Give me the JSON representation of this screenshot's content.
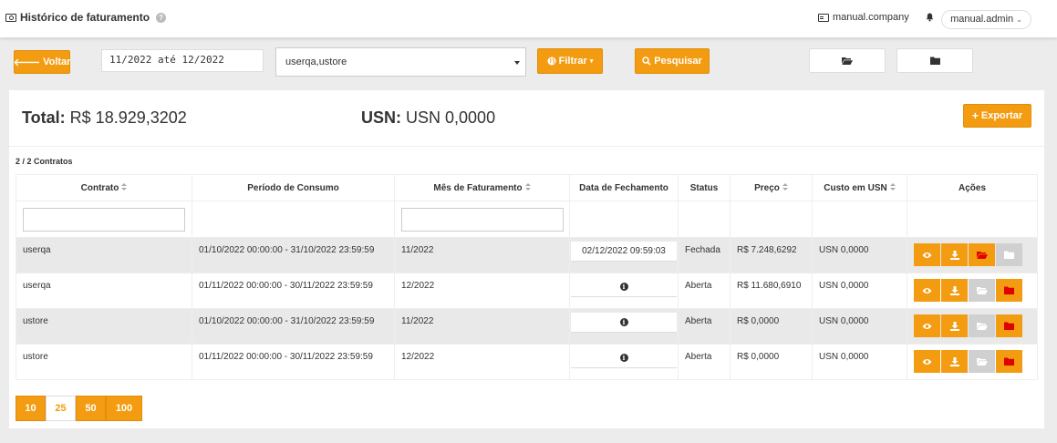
{
  "header": {
    "title": "Histórico de faturamento",
    "company": "manual.company",
    "user": "manual.admin"
  },
  "toolbar": {
    "back_label": "Voltar",
    "date_range": "11/2022 até 12/2022",
    "select_value": "userqa,ustore",
    "filter_label": "Filtrar",
    "search_label": "Pesquisar"
  },
  "summary": {
    "total_label": "Total:",
    "total_value": "R$ 18.929,3202",
    "usn_label": "USN:",
    "usn_value": "USN 0,0000",
    "export_label": "Exportar"
  },
  "table": {
    "count": "2 / 2 Contratos",
    "headers": [
      "Contrato",
      "Período de Consumo",
      "Mês de Faturamento",
      "Data de Fechamento",
      "Status",
      "Preço",
      "Custo em USN",
      "Ações"
    ],
    "rows": [
      {
        "contrato": "userqa",
        "periodo": "01/10/2022 00:00:00 - 31/10/2022 23:59:59",
        "mes": "11/2022",
        "fechamento": "02/12/2022 09:59:03",
        "status": "Fechada",
        "preco": "R$ 7.248,6292",
        "custo": "USN 0,0000"
      },
      {
        "contrato": "userqa",
        "periodo": "01/11/2022 00:00:00 - 30/11/2022 23:59:59",
        "mes": "12/2022",
        "fechamento": "",
        "status": "Aberta",
        "preco": "R$ 11.680,6910",
        "custo": "USN 0,0000"
      },
      {
        "contrato": "ustore",
        "periodo": "01/10/2022 00:00:00 - 31/10/2022 23:59:59",
        "mes": "11/2022",
        "fechamento": "",
        "status": "Aberta",
        "preco": "R$ 0,0000",
        "custo": "USN 0,0000"
      },
      {
        "contrato": "ustore",
        "periodo": "01/11/2022 00:00:00 - 30/11/2022 23:59:59",
        "mes": "12/2022",
        "fechamento": "",
        "status": "Aberta",
        "preco": "R$ 0,0000",
        "custo": "USN 0,0000"
      }
    ]
  },
  "pagination": {
    "sizes": [
      "10",
      "25",
      "50",
      "100"
    ],
    "active": "25"
  },
  "colors": {
    "accent": "#f39c12",
    "closed_status": "#2e7d32",
    "open_status": "#a52a2a",
    "folder_red": "#e00000"
  }
}
